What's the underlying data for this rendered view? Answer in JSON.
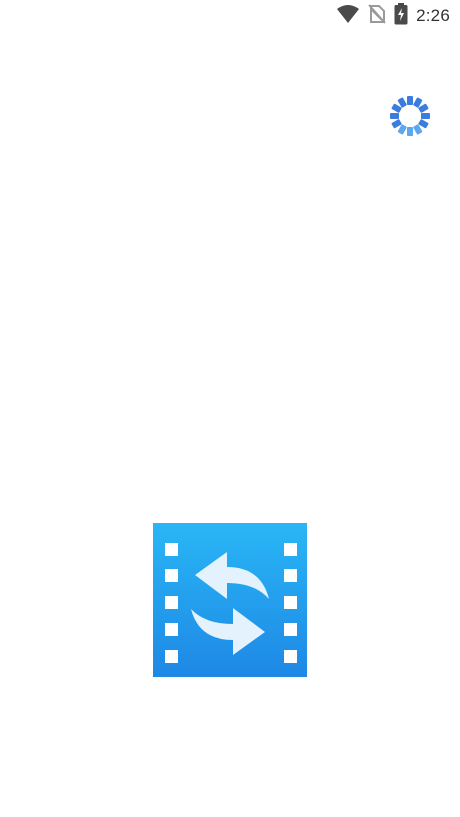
{
  "status_bar": {
    "time": "2:26",
    "icons": [
      "wifi-icon",
      "no-sim-icon",
      "battery-charging-icon"
    ]
  },
  "loader": {
    "icon": "loading-spinner-icon",
    "color": "#3B82E6"
  },
  "splash": {
    "logo_icon": "video-converter-logo-icon",
    "brand_color_top": "#29B6F6",
    "brand_color_bottom": "#1E88E5"
  }
}
